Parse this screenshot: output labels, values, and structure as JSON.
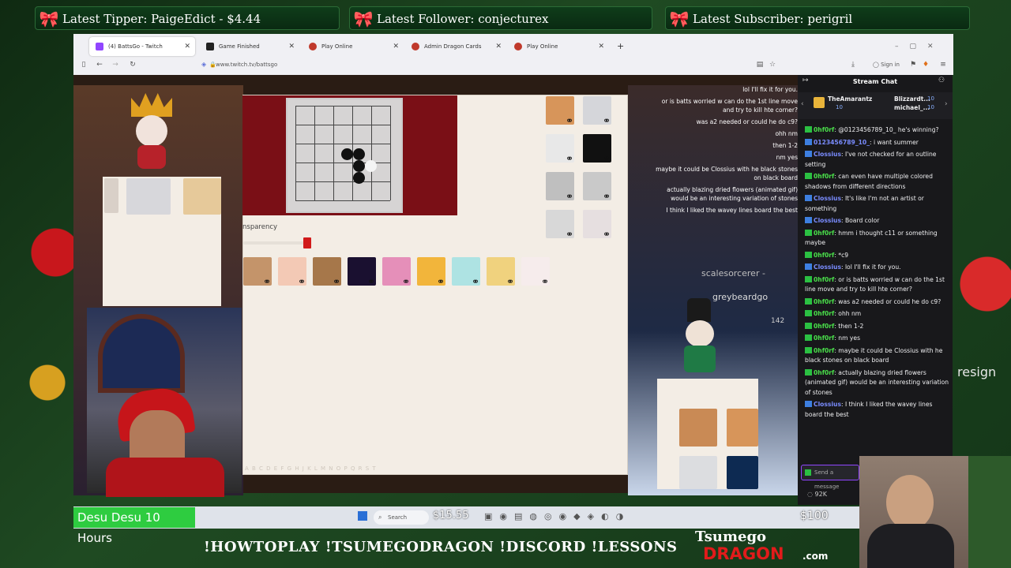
{
  "alerts": {
    "tipper": "Latest Tipper: PaigeEdict - $4.44",
    "follower": "Latest Follower: conjecturex",
    "subscriber": "Latest Subscriber: perigril"
  },
  "browser": {
    "tabs": [
      {
        "label": "(4) BattsGo - Twitch",
        "favicon_color": "#9146ff"
      },
      {
        "label": "Game Finished",
        "favicon_color": "#222222"
      },
      {
        "label": "Play Online",
        "favicon_color": "#c0392b"
      },
      {
        "label": "Admin Dragon Cards",
        "favicon_color": "#c0392b"
      },
      {
        "label": "Play Online",
        "favicon_color": "#c0392b"
      }
    ],
    "url": "www.twitch.tv/battsgo",
    "sign_in": "Sign in"
  },
  "game": {
    "transparency_label": "nsparency",
    "swatch_colors": [
      "#c4946a",
      "#f3c9b5",
      "#a6774a",
      "#1a1030",
      "#e58fb9",
      "#f2b53b",
      "#aee3e3",
      "#f0d27e",
      "#f6ecec"
    ],
    "right_swatch_colors": [
      "#d7955a",
      "#d5d6da",
      "#e8e8e8",
      "#111111",
      "#bfbfbf",
      "#c9c9c9",
      "#d8d8d8",
      "#e6dfe0"
    ],
    "column_letters": [
      "A",
      "B",
      "C",
      "D",
      "E",
      "F",
      "G",
      "H",
      "J",
      "K",
      "L",
      "M",
      "N",
      "O",
      "P",
      "Q",
      "R",
      "S",
      "T"
    ],
    "stones_black": [
      [
        2,
        2
      ],
      [
        3,
        2
      ],
      [
        3,
        3
      ],
      [
        3,
        4
      ]
    ],
    "stones_white": [
      [
        4,
        3
      ],
      [
        3,
        3
      ]
    ]
  },
  "overlay_chat": [
    "lol I'll fix it for you.",
    "or is batts worried w can do the 1st line move and try to kill hte corner?",
    "was a2 needed or could he do c9?",
    "ohh nm",
    "then 1-2",
    "nm yes",
    "maybe it could be Clossius with he black stones on black board",
    "actually blazing dried flowers (animated gif) would be an interesting variation of stones",
    "I think I liked the wavey lines board the best"
  ],
  "stream_labels": {
    "scalesorcerer": "scalesorcerer -",
    "greybeard": "greybeardgo",
    "counter": "142",
    "resign": "resign"
  },
  "chat": {
    "title": "Stream Chat",
    "top_users": [
      {
        "name": "TheAmarantz",
        "count": "10"
      },
      {
        "name": "Blizzardt...",
        "count": "10"
      },
      {
        "name": "michael_...",
        "count": "10"
      }
    ],
    "messages": [
      {
        "user": "0hf0rf",
        "text": ": @0123456789_10_ he's winning?",
        "color": "green"
      },
      {
        "user": "0123456789_10_",
        "text": ": i want summer",
        "color": "blue"
      },
      {
        "user": "Clossius",
        "text": ": I've not checked for an outline setting",
        "color": "blue"
      },
      {
        "user": "0hf0rf",
        "text": ": can even have multiple colored shadows from different directions",
        "color": "green"
      },
      {
        "user": "Clossius",
        "text": ": It's like I'm not an artist or something",
        "color": "blue"
      },
      {
        "user": "Clossius",
        "text": ": Board color",
        "color": "blue"
      },
      {
        "user": "0hf0rf",
        "text": ": hmm i thought c11 or something maybe",
        "color": "green"
      },
      {
        "user": "0hf0rf",
        "text": ": *c9",
        "color": "green"
      },
      {
        "user": "Clossius",
        "text": ": lol I'll fix it for you.",
        "color": "blue"
      },
      {
        "user": "0hf0rf",
        "text": ": or is batts worried w can do the 1st line move and try to kill hte corner?",
        "color": "green"
      },
      {
        "user": "0hf0rf",
        "text": ": was a2 needed or could he do c9?",
        "color": "green"
      },
      {
        "user": "0hf0rf",
        "text": ": ohh nm",
        "color": "green"
      },
      {
        "user": "0hf0rf",
        "text": ": then 1-2",
        "color": "green"
      },
      {
        "user": "0hf0rf",
        "text": ": nm yes",
        "color": "green"
      },
      {
        "user": "0hf0rf",
        "text": ": maybe it could be Clossius with he black stones on black board",
        "color": "green"
      },
      {
        "user": "0hf0rf",
        "text": ": actually blazing dried flowers (animated gif) would be an interesting variation of stones",
        "color": "green"
      },
      {
        "user": "Clossius",
        "text": ": I think I liked the wavey lines board the best",
        "color": "blue"
      }
    ],
    "input_placeholder": "Send a message",
    "viewers": "92K"
  },
  "bottom": {
    "goal": "Desu Desu 10 Hours",
    "search": "Search",
    "goal_amount": "$15.55",
    "goal_target": "$100",
    "commands": "!HOWTOPLAY !TSUMEGODRAGON !DISCORD !LESSONS",
    "logo_line1": "Tsumego",
    "logo_line2": "DRAGON",
    "logo_suffix": ".com"
  }
}
